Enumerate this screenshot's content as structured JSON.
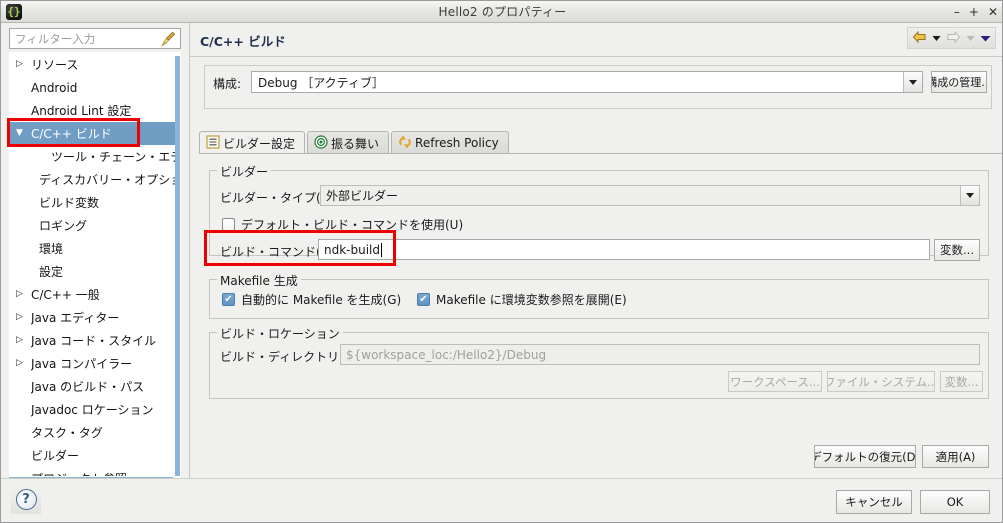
{
  "window": {
    "title": "Hello2 のプロパティー",
    "app_icon": "eclipse-icon",
    "minimize": "–",
    "maximize": "+",
    "close": "✕"
  },
  "sidebar": {
    "filter": {
      "placeholder": "フィルター入力",
      "value": "",
      "clear_icon": "broom-icon"
    },
    "items": [
      {
        "label": "リソース",
        "expandable": true,
        "expanded": false,
        "indent": 0,
        "selected": false
      },
      {
        "label": "Android",
        "expandable": false,
        "expanded": false,
        "indent": 0,
        "selected": false
      },
      {
        "label": "Android Lint 設定",
        "expandable": false,
        "expanded": false,
        "indent": 0,
        "selected": false
      },
      {
        "label": "C/C++ ビルド",
        "expandable": true,
        "expanded": true,
        "indent": 0,
        "selected": true
      },
      {
        "label": "ツール・チェーン・エディター",
        "expandable": false,
        "expanded": false,
        "indent": 2,
        "selected": false
      },
      {
        "label": "ディスカバリー・オプション",
        "expandable": false,
        "expanded": false,
        "indent": 1,
        "selected": false
      },
      {
        "label": "ビルド変数",
        "expandable": false,
        "expanded": false,
        "indent": 1,
        "selected": false
      },
      {
        "label": "ロギング",
        "expandable": false,
        "expanded": false,
        "indent": 1,
        "selected": false
      },
      {
        "label": "環境",
        "expandable": false,
        "expanded": false,
        "indent": 1,
        "selected": false
      },
      {
        "label": "設定",
        "expandable": false,
        "expanded": false,
        "indent": 1,
        "selected": false
      },
      {
        "label": "C/C++ 一般",
        "expandable": true,
        "expanded": false,
        "indent": 0,
        "selected": false
      },
      {
        "label": "Java エディター",
        "expandable": true,
        "expanded": false,
        "indent": 0,
        "selected": false
      },
      {
        "label": "Java コード・スタイル",
        "expandable": true,
        "expanded": false,
        "indent": 0,
        "selected": false
      },
      {
        "label": "Java コンパイラー",
        "expandable": true,
        "expanded": false,
        "indent": 0,
        "selected": false
      },
      {
        "label": "Java のビルド・パス",
        "expandable": false,
        "expanded": false,
        "indent": 0,
        "selected": false
      },
      {
        "label": "Javadoc ロケーション",
        "expandable": false,
        "expanded": false,
        "indent": 0,
        "selected": false
      },
      {
        "label": "タスク・タグ",
        "expandable": false,
        "expanded": false,
        "indent": 0,
        "selected": false
      },
      {
        "label": "ビルダー",
        "expandable": false,
        "expanded": false,
        "indent": 0,
        "selected": false
      },
      {
        "label": "プロジェクト参照",
        "expandable": false,
        "expanded": false,
        "indent": 0,
        "selected": false
      }
    ]
  },
  "page": {
    "title": "C/C++ ビルド",
    "nav": {
      "back_icon": "back-arrow-icon",
      "back_menu_icon": "chevron-down-icon",
      "forward_icon": "forward-arrow-icon",
      "forward_menu_icon": "chevron-down-icon",
      "view_menu_icon": "chevron-down-icon"
    },
    "configuration": {
      "label": "構成:",
      "value": "Debug ［アクティブ］",
      "dropdown_icon": "chevron-down-icon",
      "manage_button": "構成の管理..."
    },
    "tabs": [
      {
        "label": "ビルダー設定",
        "icon": "list-icon",
        "active": true
      },
      {
        "label": "振る舞い",
        "icon": "target-icon",
        "active": false
      },
      {
        "label": "Refresh Policy",
        "icon": "refresh-icon",
        "active": false
      }
    ],
    "builder_group": {
      "title": "ビルダー",
      "type_label": "ビルダー・タイプ(T):",
      "type_value": "外部ビルダー",
      "type_dropdown_icon": "chevron-down-icon",
      "use_default_label": "デフォルト・ビルド・コマンドを使用(U)",
      "use_default_checked": false,
      "command_label": "ビルド・コマンド(C):",
      "command_value": "ndk-build",
      "variables_button": "変数..."
    },
    "makefile_group": {
      "title": "Makefile 生成",
      "auto_generate_label": "自動的に Makefile を生成(G)",
      "auto_generate_checked": true,
      "expand_env_label": "Makefile に環境変数参照を展開(E)",
      "expand_env_checked": true
    },
    "build_location_group": {
      "title": "ビルド・ロケーション",
      "directory_label": "ビルド・ディレクトリー(D):",
      "directory_value": "${workspace_loc:/Hello2}/Debug",
      "workspace_button": "ワークスペース...",
      "filesystem_button": "ファイル・システム...",
      "variables_button": "変数..."
    },
    "restore_defaults_button": "デフォルトの復元(D)",
    "apply_button": "適用(A)"
  },
  "footer": {
    "help_icon": "help-icon",
    "cancel_button": "キャンセル",
    "ok_button": "OK"
  },
  "colors": {
    "selection": "#6f9dc4",
    "annotation": "#ef0000",
    "dialog_bg": "#f0f0ee",
    "title_text": "#20304a"
  }
}
